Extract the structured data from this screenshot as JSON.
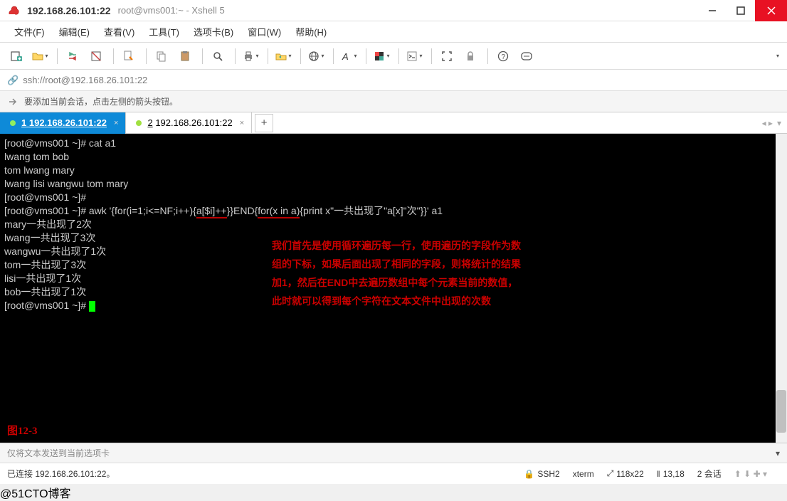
{
  "titlebar": {
    "address": "192.168.26.101:22",
    "subtitle": "root@vms001:~ - Xshell 5"
  },
  "menu": {
    "file": "文件(F)",
    "edit": "编辑(E)",
    "view": "查看(V)",
    "tools": "工具(T)",
    "tabs": "选项卡(B)",
    "window": "窗口(W)",
    "help": "帮助(H)"
  },
  "address_url": "ssh://root@192.168.26.101:22",
  "hint_text": "要添加当前会话，点击左侧的箭头按钮。",
  "tabs": {
    "active": {
      "index": "1",
      "label": "192.168.26.101:22"
    },
    "inactive": {
      "index": "2",
      "label": "192.168.26.101:22"
    }
  },
  "terminal": {
    "l1_prompt": "[root@vms001 ~]# ",
    "l1_cmd": "cat a1",
    "l2": "lwang tom bob",
    "l3": "tom lwang mary",
    "l4": "lwang lisi wangwu tom mary",
    "l5": "[root@vms001 ~]#",
    "l6_prompt": "[root@vms001 ~]# ",
    "l6_a": "awk '{for(i=1;i<=NF;i++){",
    "l6_b": "a[$i]++",
    "l6_c": "}}END{",
    "l6_d": "for(x in a)",
    "l6_e": "{print x\"一共出现了\"a[x]\"次\"}}' a1",
    "l7": "mary一共出现了2次",
    "l8": "lwang一共出现了3次",
    "l9": "wangwu一共出现了1次",
    "l10": "tom一共出现了3次",
    "l11": "lisi一共出现了1次",
    "l12": "bob一共出现了1次",
    "l13": "[root@vms001 ~]# "
  },
  "annotation": {
    "a1": "我们首先是使用循环遍历每一行，使用遍历的字段作为数",
    "a2": "组的下标，如果后面出现了相同的字段，则将统计的结果",
    "a3": "加1，然后在END中去遍历数组中每个元素当前的数值，",
    "a4": "此时就可以得到每个字符在文本文件中出现的次数"
  },
  "fig_caption": "图12-3",
  "sendbar_text": "仅将文本发送到当前选项卡",
  "status": {
    "connected": "已连接 192.168.26.101:22。",
    "proto": "SSH2",
    "term": "xterm",
    "size": "118x22",
    "cursor": "13,18",
    "sessions": "2 会话"
  },
  "watermark": "@51CTO博客"
}
